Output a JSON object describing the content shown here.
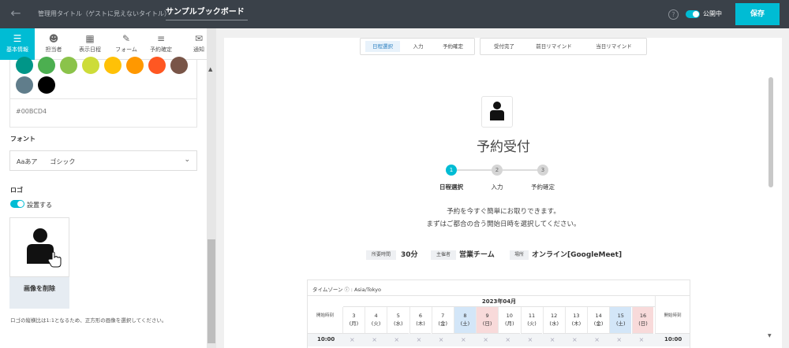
{
  "header": {
    "back_icon": "arrow-left-icon",
    "admin_title_label": "管理用タイトル（ゲストに見えないタイトル）",
    "board_title": "サンプルブックボード",
    "help_icon": "question-icon",
    "public_label": "公開中",
    "save_label": "保存"
  },
  "sidebar": {
    "tabs": [
      {
        "label": "基本情報",
        "icon": "sliders-icon"
      },
      {
        "label": "担当者",
        "icon": "users-icon"
      },
      {
        "label": "表示日程",
        "icon": "calendar-icon"
      },
      {
        "label": "フォーム",
        "icon": "edit-icon"
      },
      {
        "label": "予約確定",
        "icon": "list-check-icon"
      },
      {
        "label": "通知",
        "icon": "mail-icon"
      }
    ],
    "colors": [
      "#009688",
      "#4CAF50",
      "#8BC34A",
      "#CDDC39",
      "#FFC107",
      "#FF9800",
      "#FF5722",
      "#795548",
      "#607D8B",
      "#000000"
    ],
    "color_value": "#00BCD4",
    "font_label": "フォント",
    "font_value": "Aaあア　　ゴシック",
    "logo_label": "ロゴ",
    "logo_toggle_label": "設置する",
    "delete_image_label": "画像を削除",
    "logo_note": "ロゴの縦横比は1:1となるため、正方形の画像を選択してください。"
  },
  "preview": {
    "tabs_group1": [
      "日程選択",
      "入力",
      "予約確定"
    ],
    "tabs_group2": [
      "受付完了",
      "前日リマインド",
      "当日リマインド"
    ],
    "title": "予約受付",
    "steps": [
      {
        "num": "1",
        "label": "日程選択"
      },
      {
        "num": "2",
        "label": "入力"
      },
      {
        "num": "3",
        "label": "予約確定"
      }
    ],
    "desc_line1": "予約を今すぐ簡単にお取りできます。",
    "desc_line2": "まずはご都合の合う開始日時を選択してください。",
    "meta": [
      {
        "tag": "所要時間",
        "value": "30分"
      },
      {
        "tag": "主催者",
        "value": "営業チーム"
      },
      {
        "tag": "場所",
        "value": "オンライン[GoogleMeet]"
      }
    ],
    "calendar": {
      "timezone_label": "タイムゾーン",
      "timezone_value": "Asia/Tokyo",
      "month": "2023年04月",
      "start_time_label": "開始時刻",
      "days": [
        {
          "d": "3",
          "w": "(月)"
        },
        {
          "d": "4",
          "w": "(火)"
        },
        {
          "d": "5",
          "w": "(水)"
        },
        {
          "d": "6",
          "w": "(木)"
        },
        {
          "d": "7",
          "w": "(金)"
        },
        {
          "d": "8",
          "w": "(土)"
        },
        {
          "d": "9",
          "w": "(日)"
        },
        {
          "d": "10",
          "w": "(月)"
        },
        {
          "d": "11",
          "w": "(火)"
        },
        {
          "d": "12",
          "w": "(水)"
        },
        {
          "d": "13",
          "w": "(木)"
        },
        {
          "d": "14",
          "w": "(金)"
        },
        {
          "d": "15",
          "w": "(土)"
        },
        {
          "d": "16",
          "w": "(日)"
        }
      ],
      "row_time": "10:00",
      "unavailable_mark": "×"
    }
  }
}
